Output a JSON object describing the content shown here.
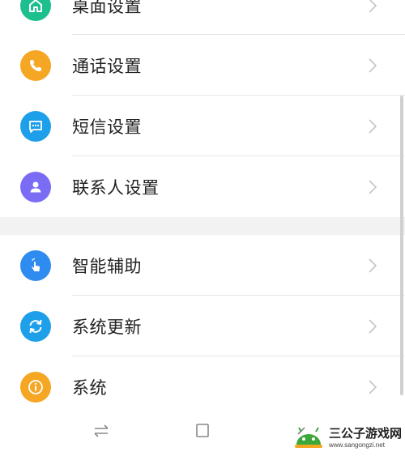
{
  "settings": {
    "items": [
      {
        "label": "桌面设置",
        "icon": "home-icon",
        "color": "#1DBF8E"
      },
      {
        "label": "通话设置",
        "icon": "phone-icon",
        "color": "#F5A623"
      },
      {
        "label": "短信设置",
        "icon": "message-icon",
        "color": "#1E9FEA"
      },
      {
        "label": "联系人设置",
        "icon": "contact-icon",
        "color": "#7B6CF6"
      },
      {
        "label": "智能辅助",
        "icon": "touch-icon",
        "color": "#2E8BF0"
      },
      {
        "label": "系统更新",
        "icon": "refresh-icon",
        "color": "#1E9FEA"
      },
      {
        "label": "系统",
        "icon": "info-icon",
        "color": "#F5A623"
      }
    ]
  },
  "watermark": {
    "title": "三公子游戏网",
    "url": "www.sangongzi.net"
  }
}
